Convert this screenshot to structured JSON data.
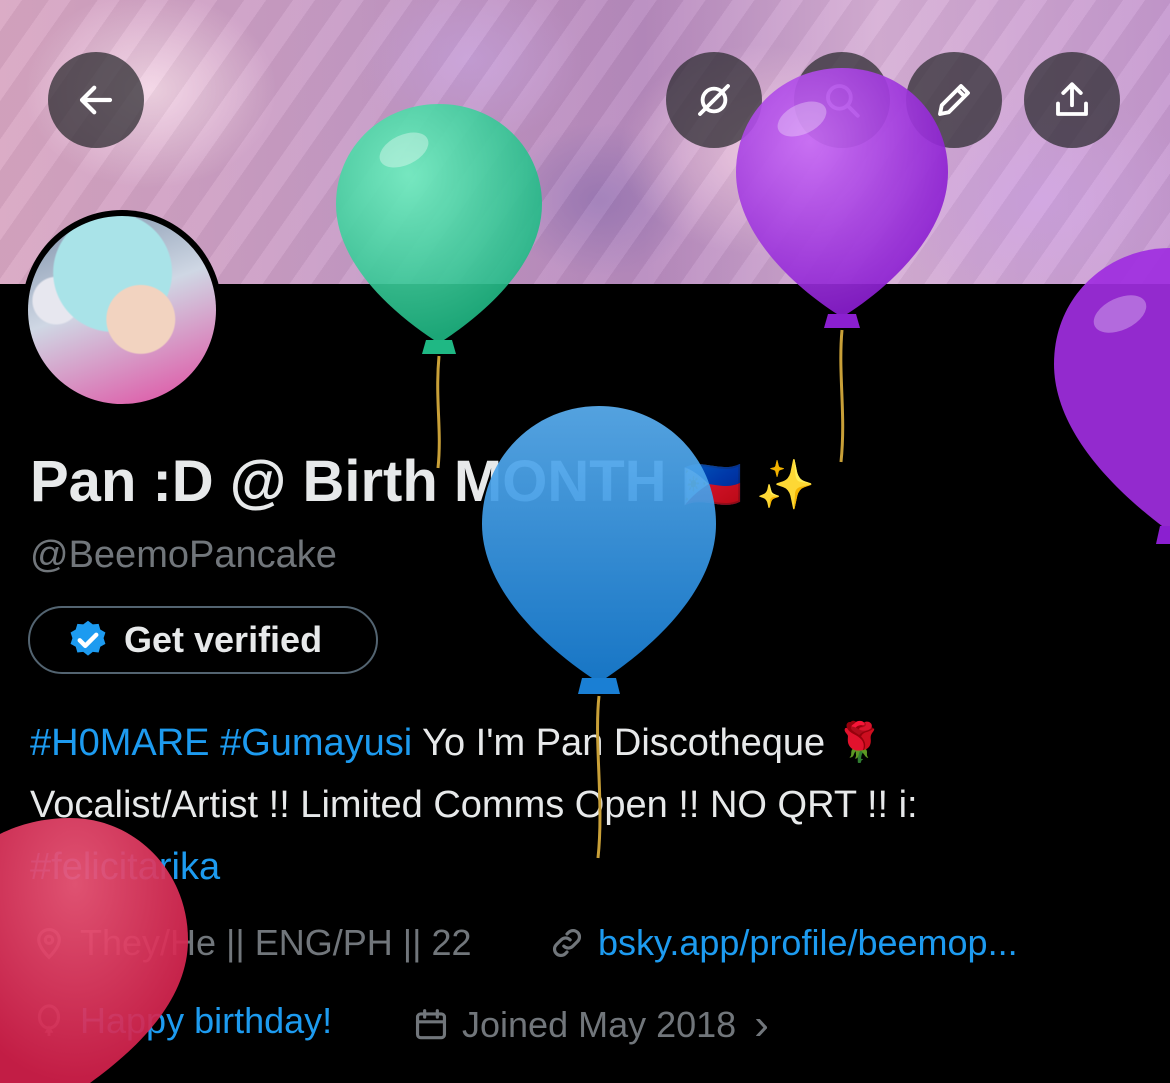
{
  "header": {
    "back_icon": "arrow-left-icon",
    "actions": [
      "grok-icon",
      "search-icon",
      "pencil-icon",
      "share-icon"
    ]
  },
  "profile": {
    "display_name": "Pan :D @ Birth MONTH",
    "name_emoji": "🇵🇭 ✨",
    "handle": "@BeemoPancake",
    "verify_label": "Get verified",
    "bio": {
      "tag1": "#H0MARE",
      "tag2": "#Gumayusi",
      "text1": " Yo I'm Pan Discotheque 🌹",
      "text2": "Vocalist/Artist !! Limited Comms Open !! NO QRT !! i:",
      "tag3": "#felicitarika"
    },
    "location": "They/He || ENG/PH || 22",
    "website": "bsky.app/profile/beemop...",
    "birthday": "Happy birthday!",
    "joined": "Joined May 2018",
    "chevron": "›"
  },
  "colors": {
    "accent": "#1d9bf0",
    "muted": "#71767b",
    "text": "#e7e9ea",
    "balloon_green": "#3fd9a0",
    "balloon_purple": "#a02ee0",
    "balloon_blue": "#2a8fe0",
    "balloon_red": "#e0345a"
  }
}
